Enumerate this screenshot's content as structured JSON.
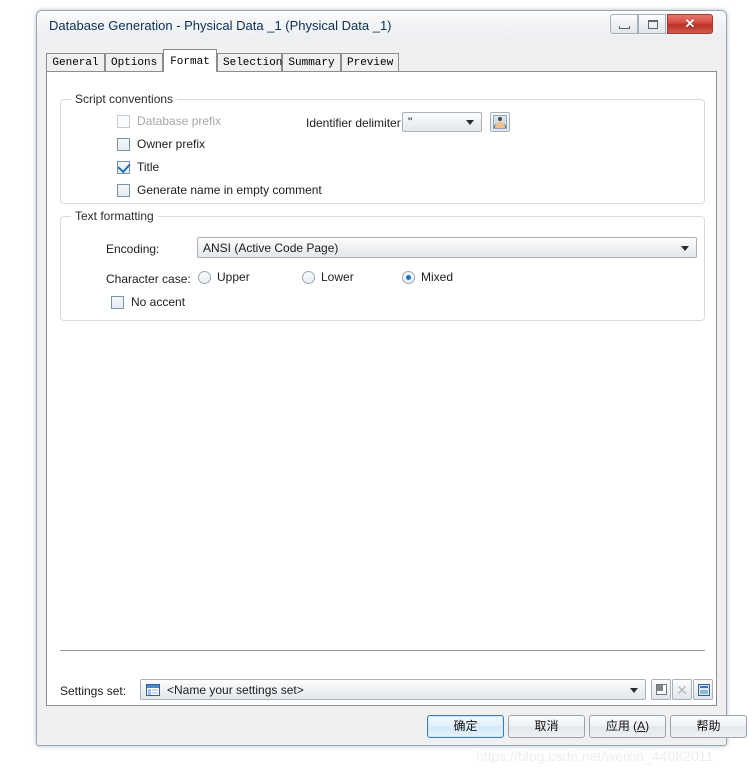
{
  "window": {
    "title": "Database Generation - Physical Data _1 (Physical Data _1)",
    "controls": {
      "minimize": "minimize-button",
      "maximize": "restore-button",
      "close": "✕"
    }
  },
  "tabs": [
    {
      "label": "General",
      "active": false
    },
    {
      "label": "Options",
      "active": false
    },
    {
      "label": "Format",
      "active": true
    },
    {
      "label": "Selection",
      "active": false
    },
    {
      "label": "Summary",
      "active": false
    },
    {
      "label": "Preview",
      "active": false
    }
  ],
  "script_conventions": {
    "title": "Script conventions",
    "checkboxes": [
      {
        "label": "Database prefix",
        "checked": false,
        "disabled": true
      },
      {
        "label": "Owner prefix",
        "checked": false,
        "disabled": false
      },
      {
        "label": "Title",
        "checked": true,
        "disabled": false
      },
      {
        "label": "Generate name in empty comment",
        "checked": false,
        "disabled": false
      }
    ],
    "identifier_delimiter": {
      "label": "Identifier delimiter:",
      "value": "\"",
      "icon": "user-avatar-icon"
    }
  },
  "text_formatting": {
    "title": "Text formatting",
    "encoding": {
      "label": "Encoding:",
      "value": "ANSI (Active Code Page)"
    },
    "character_case": {
      "label": "Character case:",
      "options": [
        {
          "label": "Upper",
          "selected": false
        },
        {
          "label": "Lower",
          "selected": false
        },
        {
          "label": "Mixed",
          "selected": true
        }
      ]
    },
    "no_accent": {
      "label": "No accent",
      "checked": false
    }
  },
  "settings_set": {
    "label": "Settings set:",
    "value": "<Name your settings set>",
    "icon": "settings-grid-icon",
    "buttons": [
      {
        "name": "save-settings-set-button",
        "icon": "save-icon",
        "disabled": false
      },
      {
        "name": "delete-settings-set-button",
        "icon": "delete-icon",
        "disabled": true
      },
      {
        "name": "properties-settings-button",
        "icon": "properties-icon",
        "disabled": false
      }
    ]
  },
  "footer": {
    "ok": "确定",
    "cancel": "取消",
    "apply_prefix": "应用 (",
    "apply_key": "A",
    "apply_suffix": ")",
    "help": "帮助"
  },
  "watermark": "https://blog.csdn.net/weixin_44082011",
  "colors": {
    "accent": "#1573c8",
    "title_text": "#0a3059",
    "close_red": "#bc2f26",
    "group_border": "#d5dde4"
  }
}
